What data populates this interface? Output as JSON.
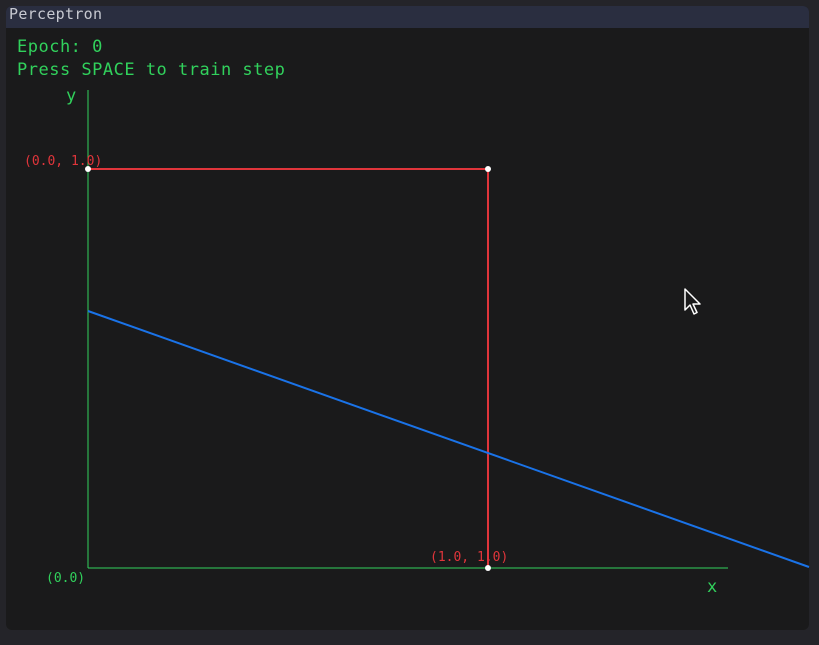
{
  "window": {
    "title": "Perceptron"
  },
  "hud": {
    "epoch_text": "Epoch: 0",
    "instruction": "Press SPACE to train step"
  },
  "plot": {
    "y_axis_label": "y",
    "x_axis_label": "x",
    "origin_label": "(0.0)",
    "point_top_left_label": "(0.0, 1.0)",
    "point_bottom_right_label": "(1.0, 1.0)"
  },
  "colors": {
    "axis": "#31d15c",
    "box": "#e0353b",
    "decision_line": "#1a73e8",
    "points": "#ffffff",
    "background": "#1a1a1b"
  },
  "icons": {
    "cursor": "mouse-pointer-icon"
  }
}
